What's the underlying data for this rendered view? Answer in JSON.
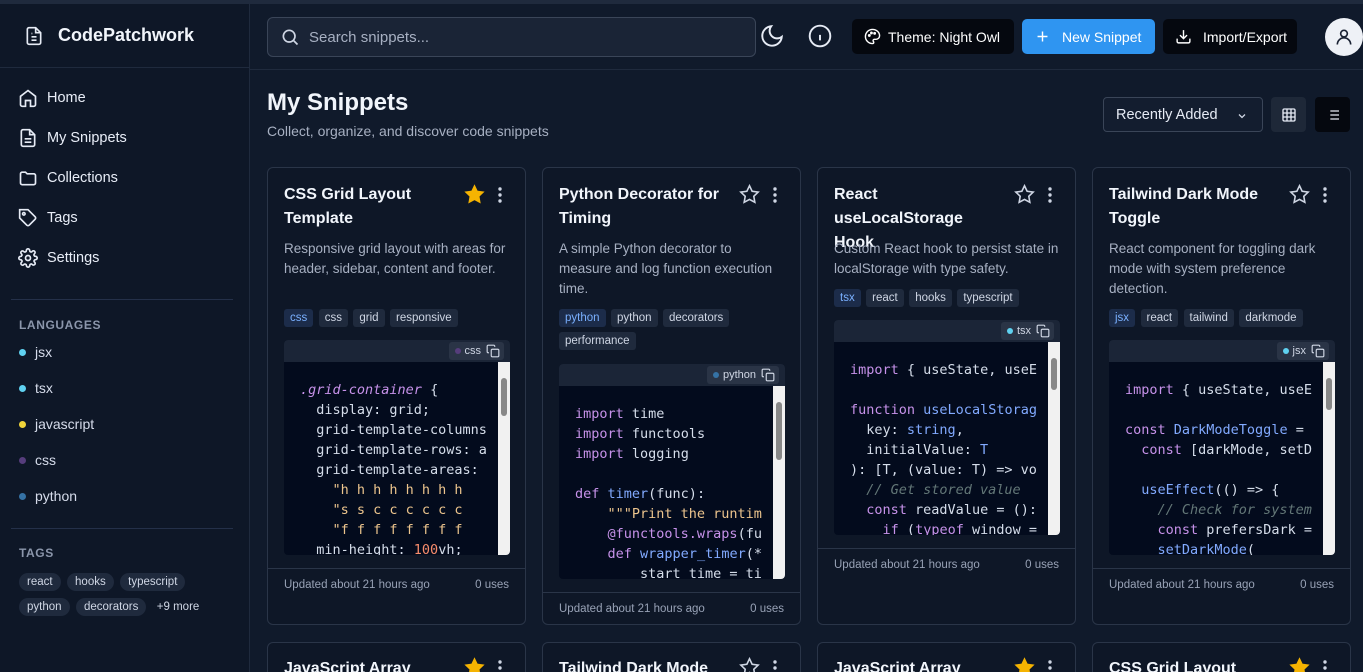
{
  "app": {
    "name": "CodePatchwork"
  },
  "sidebar": {
    "nav": [
      {
        "label": "Home",
        "icon": "home-icon"
      },
      {
        "label": "My Snippets",
        "icon": "file-icon"
      },
      {
        "label": "Collections",
        "icon": "folder-icon"
      },
      {
        "label": "Tags",
        "icon": "tag-icon"
      },
      {
        "label": "Settings",
        "icon": "gear-icon"
      }
    ],
    "languages_title": "LANGUAGES",
    "languages": [
      {
        "label": "jsx",
        "color": "#5fd1f0"
      },
      {
        "label": "tsx",
        "color": "#5fd1f0"
      },
      {
        "label": "javascript",
        "color": "#f0d43a"
      },
      {
        "label": "css",
        "color": "#563d7c"
      },
      {
        "label": "python",
        "color": "#3572a5"
      }
    ],
    "tags_title": "TAGS",
    "tags": [
      "react",
      "hooks",
      "typescript",
      "python",
      "decorators"
    ],
    "more_tags": "+9 more"
  },
  "topbar": {
    "search_placeholder": "Search snippets...",
    "theme_label": "Theme: Night Owl",
    "new_label": "New Snippet",
    "import_label": "Import/Export"
  },
  "main": {
    "title": "My Snippets",
    "subtitle": "Collect, organize, and discover code snippets",
    "sort_value": "Recently Added"
  },
  "cards": [
    {
      "title": "CSS Grid Layout Template",
      "starred": true,
      "description": "Responsive grid layout with areas for header, sidebar, content and footer.",
      "tags": [
        "css",
        "css",
        "grid",
        "responsive"
      ],
      "language": "css",
      "lang_color": "#563d7c",
      "updated": "Updated about 21 hours ago",
      "uses": "0 uses"
    },
    {
      "title": "Python Decorator for Timing",
      "starred": false,
      "description": "A simple Python decorator to measure and log function execution time.",
      "tags": [
        "python",
        "python",
        "decorators",
        "performance"
      ],
      "language": "python",
      "lang_color": "#3572a5",
      "updated": "Updated about 21 hours ago",
      "uses": "0 uses"
    },
    {
      "title": "React useLocalStorage Hook",
      "starred": false,
      "description": "Custom React hook to persist state in localStorage with type safety.",
      "tags": [
        "tsx",
        "react",
        "hooks",
        "typescript"
      ],
      "language": "tsx",
      "lang_color": "#5fd1f0",
      "updated": "Updated about 21 hours ago",
      "uses": "0 uses"
    },
    {
      "title": "Tailwind Dark Mode Toggle",
      "starred": false,
      "description": "React component for toggling dark mode with system preference detection.",
      "tags": [
        "jsx",
        "react",
        "tailwind",
        "darkmode"
      ],
      "language": "jsx",
      "lang_color": "#5fd1f0",
      "updated": "Updated about 21 hours ago",
      "uses": "0 uses"
    }
  ],
  "bottom_cards": [
    {
      "title": "JavaScript Array",
      "starred": true
    },
    {
      "title": "Tailwind Dark Mode",
      "starred": false
    },
    {
      "title": "JavaScript Array",
      "starred": true
    },
    {
      "title": "CSS Grid Layout",
      "starred": true
    }
  ],
  "colors": {
    "accent": "#2f95f1",
    "star": "#f5b301"
  }
}
